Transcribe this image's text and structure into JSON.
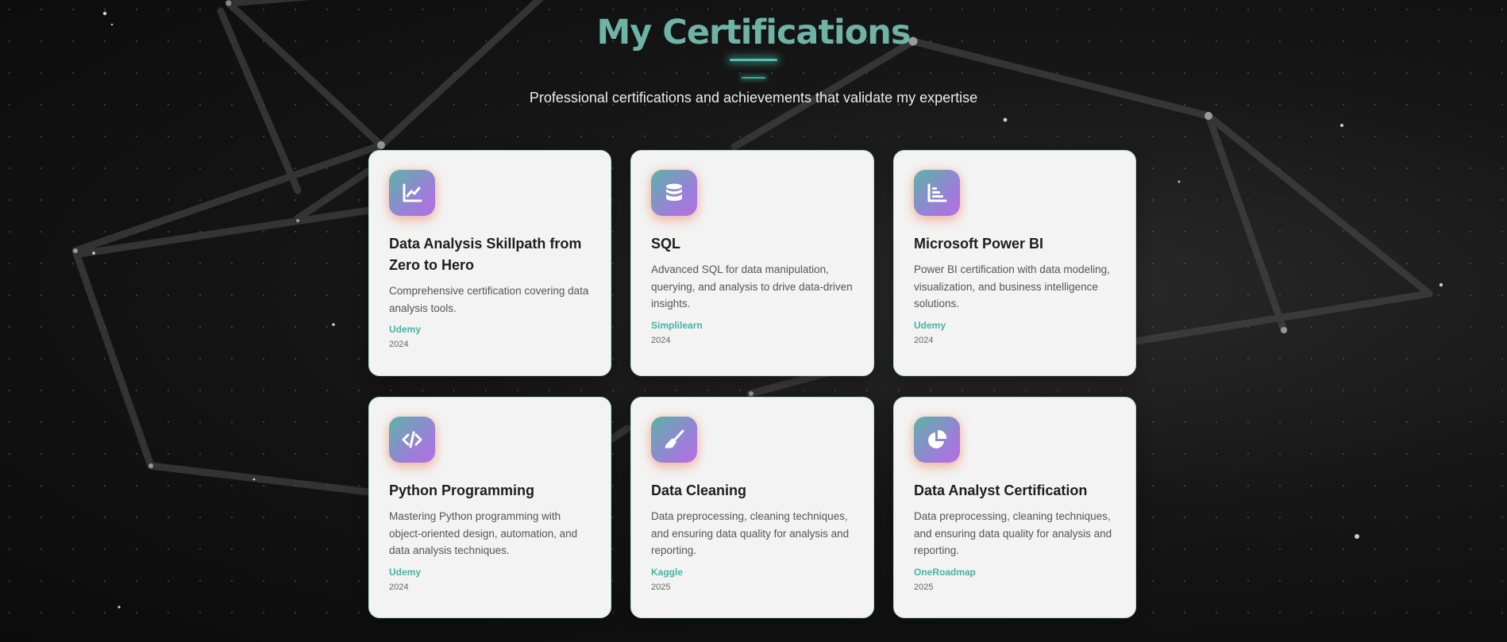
{
  "header": {
    "title": "My Certifications",
    "subtitle": "Professional certifications and achievements that validate my expertise"
  },
  "colors": {
    "accent": "#4fc3b5",
    "title": "#6fb3a7",
    "card_bg": "#f3f3f3"
  },
  "certifications": [
    {
      "icon": "line-chart-icon",
      "title": "Data Analysis Skillpath from Zero to Hero",
      "description": "Comprehensive certification covering data analysis tools.",
      "issuer": "Udemy",
      "year": "2024"
    },
    {
      "icon": "database-icon",
      "title": "SQL",
      "description": "Advanced SQL for data manipulation, querying, and analysis to drive data-driven insights.",
      "issuer": "Simplilearn",
      "year": "2024"
    },
    {
      "icon": "bar-chart-icon",
      "title": "Microsoft Power BI",
      "description": "Power BI certification with data modeling, visualization, and business intelligence solutions.",
      "issuer": "Udemy",
      "year": "2024"
    },
    {
      "icon": "code-icon",
      "title": "Python Programming",
      "description": "Mastering Python programming with object-oriented design, automation, and data analysis techniques.",
      "issuer": "Udemy",
      "year": "2024"
    },
    {
      "icon": "broom-icon",
      "title": "Data Cleaning",
      "description": "Data preprocessing, cleaning techniques, and ensuring data quality for analysis and reporting.",
      "issuer": "Kaggle",
      "year": "2025"
    },
    {
      "icon": "pie-chart-icon",
      "title": "Data Analyst Certification",
      "description": "Data preprocessing, cleaning techniques, and ensuring data quality for analysis and reporting.",
      "issuer": "OneRoadmap",
      "year": "2025"
    }
  ]
}
